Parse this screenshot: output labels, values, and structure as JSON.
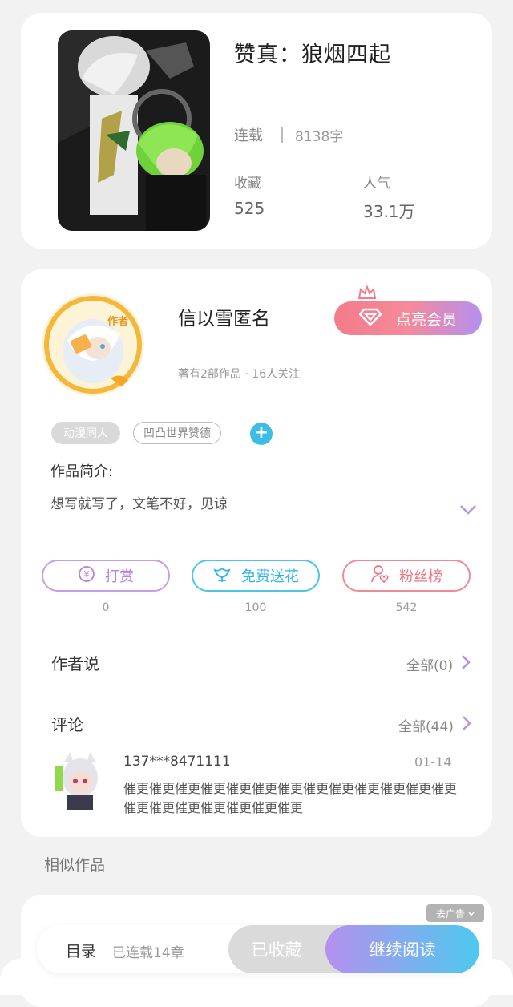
{
  "book": {
    "title": "赞真：狼烟四起",
    "status": "连载",
    "word_count": "8138字",
    "favorites_label": "收藏",
    "favorites_value": "525",
    "popularity_label": "人气",
    "popularity_value": "33.1万"
  },
  "author": {
    "name": "信以雪匿名",
    "meta": "著有2部作品 · 16人关注",
    "avatar_badge": "作者",
    "vip_button": "点亮会员",
    "tags": [
      "动漫同人",
      "凹凸世界赞德"
    ],
    "intro_label": "作品简介:",
    "intro_text": "想写就写了，文笔不好，见谅"
  },
  "actions": {
    "reward": {
      "label": "打赏",
      "count": "0"
    },
    "flower": {
      "label": "免费送花",
      "count": "100"
    },
    "fans": {
      "label": "粉丝榜",
      "count": "542"
    }
  },
  "author_says": {
    "title": "作者说",
    "more": "全部(0)"
  },
  "comments": {
    "title": "评论",
    "more": "全部(44)",
    "items": [
      {
        "user": "137***8471111",
        "date": "01-14",
        "text": "催更催更催更催更催更催更催更催更催更催更催更催更催更催更催更催更催更催更催更催更"
      }
    ]
  },
  "similar": {
    "title": "相似作品",
    "ad_label": "去广告"
  },
  "bottom_bar": {
    "toc_label": "目录",
    "toc_count": "已连载14章",
    "collected": "已收藏",
    "continue": "继续阅读"
  },
  "colors": {
    "accent_blue": "#3cbde8",
    "vip_pink": "#f47b8a",
    "reward_purple": "#b681e0",
    "flower_cyan": "#2cb6e3",
    "fans_red": "#ee7680"
  }
}
